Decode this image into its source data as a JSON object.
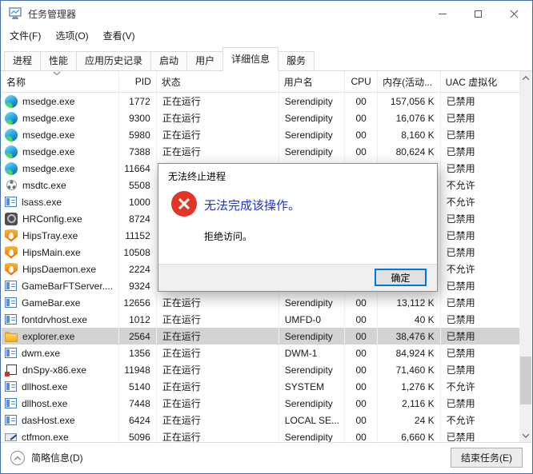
{
  "window": {
    "title": "任务管理器"
  },
  "menu": {
    "items": [
      {
        "label": "文件(F)"
      },
      {
        "label": "选项(O)"
      },
      {
        "label": "查看(V)"
      }
    ]
  },
  "tabs": {
    "items": [
      {
        "key": "processes",
        "label": "进程",
        "active": false
      },
      {
        "key": "performance",
        "label": "性能",
        "active": false
      },
      {
        "key": "app-history",
        "label": "应用历史记录",
        "active": false
      },
      {
        "key": "startup",
        "label": "启动",
        "active": false
      },
      {
        "key": "users",
        "label": "用户",
        "active": false
      },
      {
        "key": "details",
        "label": "详细信息",
        "active": true
      },
      {
        "key": "services",
        "label": "服务",
        "active": false
      }
    ]
  },
  "table": {
    "columns": [
      {
        "label": "名称",
        "sort": "desc"
      },
      {
        "label": "PID"
      },
      {
        "label": "状态"
      },
      {
        "label": "用户名"
      },
      {
        "label": "CPU"
      },
      {
        "label": "内存(活动..."
      },
      {
        "label": "UAC 虚拟化"
      }
    ],
    "rows": [
      {
        "icon": "edge",
        "name": "msedge.exe",
        "pid": "1772",
        "status": "正在运行",
        "user": "Serendipity",
        "cpu": "00",
        "mem": "157,056 K",
        "uac": "已禁用",
        "selected": false
      },
      {
        "icon": "edge",
        "name": "msedge.exe",
        "pid": "9300",
        "status": "正在运行",
        "user": "Serendipity",
        "cpu": "00",
        "mem": "16,076 K",
        "uac": "已禁用",
        "selected": false
      },
      {
        "icon": "edge",
        "name": "msedge.exe",
        "pid": "5980",
        "status": "正在运行",
        "user": "Serendipity",
        "cpu": "00",
        "mem": "8,160 K",
        "uac": "已禁用",
        "selected": false
      },
      {
        "icon": "edge",
        "name": "msedge.exe",
        "pid": "7388",
        "status": "正在运行",
        "user": "Serendipity",
        "cpu": "00",
        "mem": "80,624 K",
        "uac": "已禁用",
        "selected": false
      },
      {
        "icon": "edge",
        "name": "msedge.exe",
        "pid": "11664",
        "status": "",
        "user": "",
        "cpu": "",
        "mem": "",
        "uac": "已禁用",
        "selected": false
      },
      {
        "icon": "network",
        "name": "msdtc.exe",
        "pid": "5508",
        "status": "",
        "user": "",
        "cpu": "",
        "mem": "",
        "uac": "不允许",
        "selected": false
      },
      {
        "icon": "default",
        "name": "lsass.exe",
        "pid": "1000",
        "status": "",
        "user": "",
        "cpu": "",
        "mem": "",
        "uac": "不允许",
        "selected": false
      },
      {
        "icon": "gear",
        "name": "HRConfig.exe",
        "pid": "8724",
        "status": "",
        "user": "",
        "cpu": "",
        "mem": "",
        "uac": "已禁用",
        "selected": false
      },
      {
        "icon": "hips",
        "name": "HipsTray.exe",
        "pid": "11152",
        "status": "",
        "user": "",
        "cpu": "",
        "mem": "",
        "uac": "已禁用",
        "selected": false
      },
      {
        "icon": "hips",
        "name": "HipsMain.exe",
        "pid": "10508",
        "status": "",
        "user": "",
        "cpu": "",
        "mem": "",
        "uac": "已禁用",
        "selected": false
      },
      {
        "icon": "hips",
        "name": "HipsDaemon.exe",
        "pid": "2224",
        "status": "",
        "user": "",
        "cpu": "",
        "mem": "",
        "uac": "不允许",
        "selected": false
      },
      {
        "icon": "default",
        "name": "GameBarFTServer....",
        "pid": "9324",
        "status": "",
        "user": "",
        "cpu": "",
        "mem": "",
        "uac": "已禁用",
        "selected": false
      },
      {
        "icon": "default",
        "name": "GameBar.exe",
        "pid": "12656",
        "status": "正在运行",
        "user": "Serendipity",
        "cpu": "00",
        "mem": "13,112 K",
        "uac": "已禁用",
        "selected": false
      },
      {
        "icon": "default",
        "name": "fontdrvhost.exe",
        "pid": "1012",
        "status": "正在运行",
        "user": "UMFD-0",
        "cpu": "00",
        "mem": "40 K",
        "uac": "已禁用",
        "selected": false
      },
      {
        "icon": "folder",
        "name": "explorer.exe",
        "pid": "2564",
        "status": "正在运行",
        "user": "Serendipity",
        "cpu": "00",
        "mem": "38,476 K",
        "uac": "已禁用",
        "selected": true
      },
      {
        "icon": "default",
        "name": "dwm.exe",
        "pid": "1356",
        "status": "正在运行",
        "user": "DWM-1",
        "cpu": "00",
        "mem": "84,924 K",
        "uac": "已禁用",
        "selected": false
      },
      {
        "icon": "dnspy",
        "name": "dnSpy-x86.exe",
        "pid": "11948",
        "status": "正在运行",
        "user": "Serendipity",
        "cpu": "00",
        "mem": "71,460 K",
        "uac": "已禁用",
        "selected": false
      },
      {
        "icon": "default",
        "name": "dllhost.exe",
        "pid": "5140",
        "status": "正在运行",
        "user": "SYSTEM",
        "cpu": "00",
        "mem": "1,276 K",
        "uac": "不允许",
        "selected": false
      },
      {
        "icon": "default",
        "name": "dllhost.exe",
        "pid": "7448",
        "status": "正在运行",
        "user": "Serendipity",
        "cpu": "00",
        "mem": "2,116 K",
        "uac": "已禁用",
        "selected": false
      },
      {
        "icon": "default",
        "name": "dasHost.exe",
        "pid": "6424",
        "status": "正在运行",
        "user": "LOCAL SE...",
        "cpu": "00",
        "mem": "24 K",
        "uac": "不允许",
        "selected": false
      },
      {
        "icon": "keyboard",
        "name": "ctfmon.exe",
        "pid": "5096",
        "status": "正在运行",
        "user": "Serendipity",
        "cpu": "00",
        "mem": "6,660 K",
        "uac": "已禁用",
        "selected": false
      }
    ]
  },
  "dialog": {
    "title": "无法终止进程",
    "message": "无法完成该操作。",
    "detail": "拒绝访问。",
    "ok_label": "确定"
  },
  "footer": {
    "toggle_label": "简略信息(D)",
    "end_task_label": "结束任务(E)"
  },
  "colors": {
    "accent": "#0078d7",
    "dialog_message_blue": "#2135c8",
    "error_red": "#e23528",
    "selected_row_gray": "#d3d3d3"
  }
}
